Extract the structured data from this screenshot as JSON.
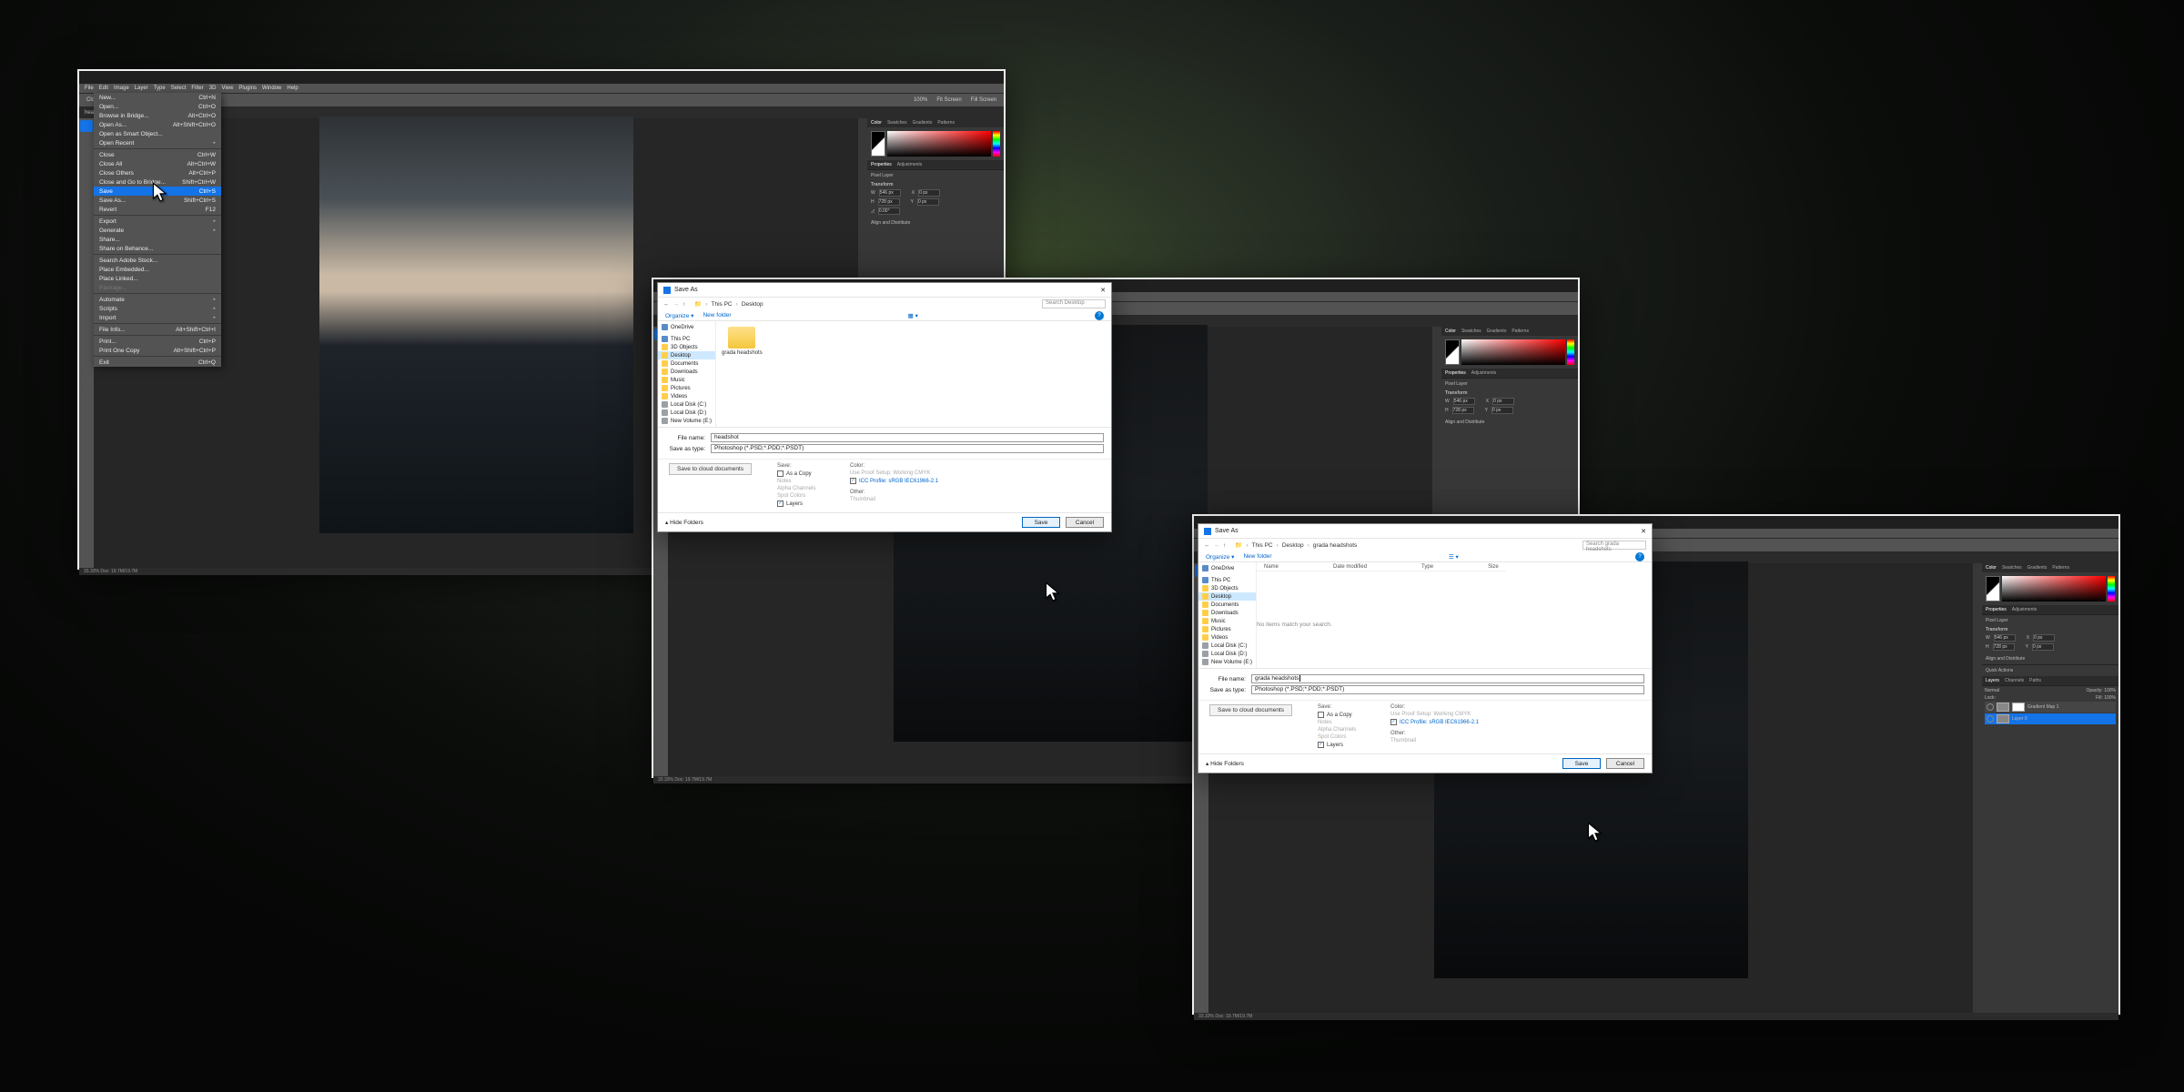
{
  "photoshop": {
    "menubar": [
      "File",
      "Edit",
      "Image",
      "Layer",
      "Type",
      "Select",
      "Filter",
      "3D",
      "View",
      "Plugins",
      "Window",
      "Help"
    ],
    "options_bar": {
      "close_windows": "Close All Windows",
      "zoom": "100%",
      "fit": "Fit Screen",
      "fill": "Fill Screen"
    },
    "tab_title": "headshot.tiff @ 33.3% (Layer 0, RGB/8) *",
    "status": "33.33%   Doc: 19.7M/19.7M"
  },
  "file_menu": {
    "items": [
      {
        "label": "New...",
        "short": "Ctrl+N"
      },
      {
        "label": "Open...",
        "short": "Ctrl+O"
      },
      {
        "label": "Browse in Bridge...",
        "short": "Alt+Ctrl+O"
      },
      {
        "label": "Open As...",
        "short": "Alt+Shift+Ctrl+O"
      },
      {
        "label": "Open as Smart Object...",
        "short": ""
      },
      {
        "label": "Open Recent",
        "short": "",
        "arrow": true
      },
      {
        "sep": true
      },
      {
        "label": "Close",
        "short": "Ctrl+W"
      },
      {
        "label": "Close All",
        "short": "Alt+Ctrl+W"
      },
      {
        "label": "Close Others",
        "short": "Alt+Ctrl+P"
      },
      {
        "label": "Close and Go to Bridge...",
        "short": "Shift+Ctrl+W"
      },
      {
        "label": "Save",
        "short": "Ctrl+S",
        "hi": true
      },
      {
        "label": "Save As...",
        "short": "Shift+Ctrl+S"
      },
      {
        "label": "Revert",
        "short": "F12"
      },
      {
        "sep": true
      },
      {
        "label": "Export",
        "short": "",
        "arrow": true
      },
      {
        "label": "Generate",
        "short": "",
        "arrow": true
      },
      {
        "label": "Share...",
        "short": ""
      },
      {
        "label": "Share on Behance...",
        "short": ""
      },
      {
        "sep": true
      },
      {
        "label": "Search Adobe Stock...",
        "short": ""
      },
      {
        "label": "Place Embedded...",
        "short": ""
      },
      {
        "label": "Place Linked...",
        "short": ""
      },
      {
        "label": "Package...",
        "short": "",
        "dis": true
      },
      {
        "sep": true
      },
      {
        "label": "Automate",
        "short": "",
        "arrow": true
      },
      {
        "label": "Scripts",
        "short": "",
        "arrow": true
      },
      {
        "label": "Import",
        "short": "",
        "arrow": true
      },
      {
        "sep": true
      },
      {
        "label": "File Info...",
        "short": "Alt+Shift+Ctrl+I"
      },
      {
        "sep": true
      },
      {
        "label": "Print...",
        "short": "Ctrl+P"
      },
      {
        "label": "Print One Copy",
        "short": "Alt+Shift+Ctrl+P"
      },
      {
        "sep": true
      },
      {
        "label": "Exit",
        "short": "Ctrl+Q"
      }
    ]
  },
  "panels": {
    "color_tabs": [
      "Color",
      "Swatches",
      "Gradients",
      "Patterns"
    ],
    "prop_tabs": [
      "Properties",
      "Adjustments"
    ],
    "pixel_layer": "Pixel Layer",
    "transform_hdr": "Transform",
    "w_label": "W",
    "w_val": "546 px",
    "h_label": "H",
    "h_val": "728 px",
    "x_label": "X",
    "x_val": "0 px",
    "y_label": "Y",
    "y_val": "0 px",
    "angle_val": "0.00°",
    "align_hdr": "Align and Distribute",
    "quick_hdr": "Quick Actions",
    "layers_tabs": [
      "Layers",
      "Channels",
      "Paths"
    ],
    "layer_mode": "Normal",
    "layer_opacity": "Opacity: 100%",
    "layer_fill": "Fill: 100%",
    "layer_lock": "Lock:",
    "layer1": "Gradient Map 1",
    "layer0": "Layer 0"
  },
  "save_dialog_1": {
    "title": "Save As",
    "breadcrumb": [
      "This PC",
      "Desktop"
    ],
    "search_placeholder": "Search Desktop",
    "organize": "Organize ▾",
    "new_folder": "New folder",
    "tree": [
      {
        "label": "OneDrive",
        "ico": "pc"
      },
      {
        "sep": true
      },
      {
        "label": "This PC",
        "ico": "pc"
      },
      {
        "label": "3D Objects"
      },
      {
        "label": "Desktop",
        "sel": true
      },
      {
        "label": "Documents"
      },
      {
        "label": "Downloads"
      },
      {
        "label": "Music"
      },
      {
        "label": "Pictures"
      },
      {
        "label": "Videos"
      },
      {
        "label": "Local Disk (C:)",
        "ico": "drv"
      },
      {
        "label": "Local Disk (D:)",
        "ico": "drv"
      },
      {
        "label": "New Volume (E:)",
        "ico": "drv"
      }
    ],
    "folder_name": "grada headshots",
    "file_name_label": "File name:",
    "file_name_value": "headshot",
    "save_type_label": "Save as type:",
    "save_type_value": "Photoshop (*.PSD;*.PDD;*.PSDT)",
    "cloud_btn": "Save to cloud documents",
    "opts": {
      "save_hdr": "Save:",
      "as_copy": "As a Copy",
      "notes": "Notes",
      "alpha": "Alpha Channels",
      "spot": "Spot Colors",
      "layers": "Layers",
      "color_hdr": "Color:",
      "proof": "Use Proof Setup: Working CMYK",
      "icc": "ICC Profile: sRGB IEC61966-2.1",
      "other_hdr": "Other:",
      "thumb": "Thumbnail"
    },
    "hide": "▴ Hide Folders",
    "save_btn": "Save",
    "cancel_btn": "Cancel"
  },
  "save_dialog_2": {
    "title": "Save As",
    "breadcrumb": [
      "This PC",
      "Desktop",
      "grada headshots"
    ],
    "search_placeholder": "Search grada headshots",
    "organize": "Organize ▾",
    "new_folder": "New folder",
    "columns": [
      "Name",
      "Date modified",
      "Type",
      "Size"
    ],
    "empty_msg": "No items match your search.",
    "tree": [
      {
        "label": "OneDrive",
        "ico": "pc"
      },
      {
        "sep": true
      },
      {
        "label": "This PC",
        "ico": "pc"
      },
      {
        "label": "3D Objects"
      },
      {
        "label": "Desktop",
        "sel": true
      },
      {
        "label": "Documents"
      },
      {
        "label": "Downloads"
      },
      {
        "label": "Music"
      },
      {
        "label": "Pictures"
      },
      {
        "label": "Videos"
      },
      {
        "label": "Local Disk (C:)",
        "ico": "drv"
      },
      {
        "label": "Local Disk (D:)",
        "ico": "drv"
      },
      {
        "label": "New Volume (E:)",
        "ico": "drv"
      }
    ],
    "file_name_label": "File name:",
    "file_name_value": "grada headshots",
    "save_type_label": "Save as type:",
    "save_type_value": "Photoshop (*.PSD;*.PDD;*.PSDT)",
    "cloud_btn": "Save to cloud documents",
    "opts": {
      "save_hdr": "Save:",
      "as_copy": "As a Copy",
      "notes": "Notes",
      "alpha": "Alpha Channels",
      "spot": "Spot Colors",
      "layers": "Layers",
      "color_hdr": "Color:",
      "proof": "Use Proof Setup: Working CMYK",
      "icc": "ICC Profile: sRGB IEC61966-2.1",
      "other_hdr": "Other:",
      "thumb": "Thumbnail"
    },
    "hide": "▴ Hide Folders",
    "save_btn": "Save",
    "cancel_btn": "Cancel"
  }
}
